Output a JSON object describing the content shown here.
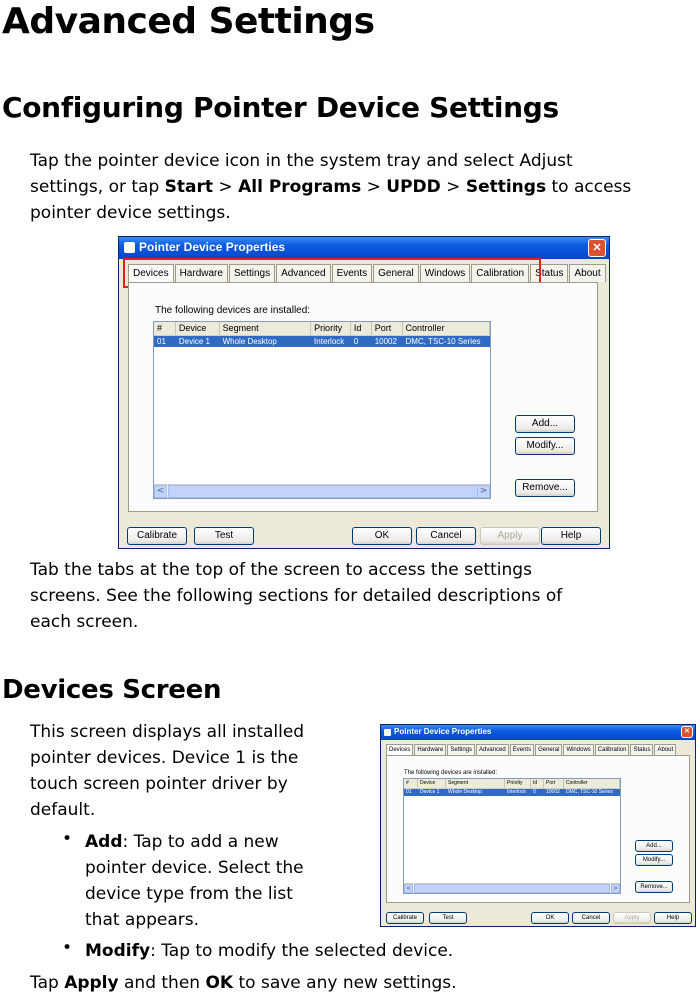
{
  "heading": "Advanced Settings",
  "section1": {
    "title": "Configuring Pointer Device Settings",
    "intro_line1": "Tap the pointer device icon in the system tray and select Adjust",
    "intro_line2_a": "settings, or tap ",
    "intro_start": "Start",
    "sep": " > ",
    "intro_all_programs": "All Programs",
    "intro_updd": "UPDD",
    "intro_settings": "Settings",
    "intro_line2_b": " to access",
    "intro_line3": "pointer device settings.",
    "after_line1": "Tab the tabs at the top of the screen to access the settings",
    "after_line2": "screens. See the following sections for detailed descriptions of",
    "after_line3": "each screen."
  },
  "section2": {
    "title": "Devices Screen",
    "line1": "This screen displays all installed",
    "line2": "pointer devices. Device 1 is the",
    "line3": "touch screen pointer driver by",
    "line4": "default.",
    "bullet_dot": "•",
    "add_term": "Add",
    "add_line1": ": Tap to add a new",
    "add_line2": "pointer device. Select the",
    "add_line3": "device type from the list",
    "add_line4": "that appears.",
    "modify_term": "Modify",
    "modify_text": ": Tap to modify the selected device.",
    "final_a": "Tap ",
    "final_apply": "Apply",
    "final_b": " and then ",
    "final_ok": "OK",
    "final_c": " to save any new settings."
  },
  "dialog": {
    "title": "Pointer Device Properties",
    "close_glyph": "✕",
    "tabs": [
      "Devices",
      "Hardware",
      "Settings",
      "Advanced",
      "Events",
      "General",
      "Windows",
      "Calibration",
      "Status",
      "About"
    ],
    "installed_label": "The following devices are installed:",
    "columns": [
      "#",
      "Device",
      "Segment",
      "Priority",
      "Id",
      "Port",
      "Controller"
    ],
    "row": [
      "01",
      "Device 1",
      "Whole Desktop",
      "Interlock",
      "0",
      "10002",
      "DMC, TSC-10 Series"
    ],
    "add_btn": "Add...",
    "modify_btn": "Modify...",
    "remove_btn": "Remove...",
    "calibrate_btn": "Calibrate",
    "test_btn": "Test",
    "ok_btn": "OK",
    "cancel_btn": "Cancel",
    "apply_btn": "Apply",
    "help_btn": "Help",
    "scroll_left": "<",
    "scroll_right": ">"
  }
}
